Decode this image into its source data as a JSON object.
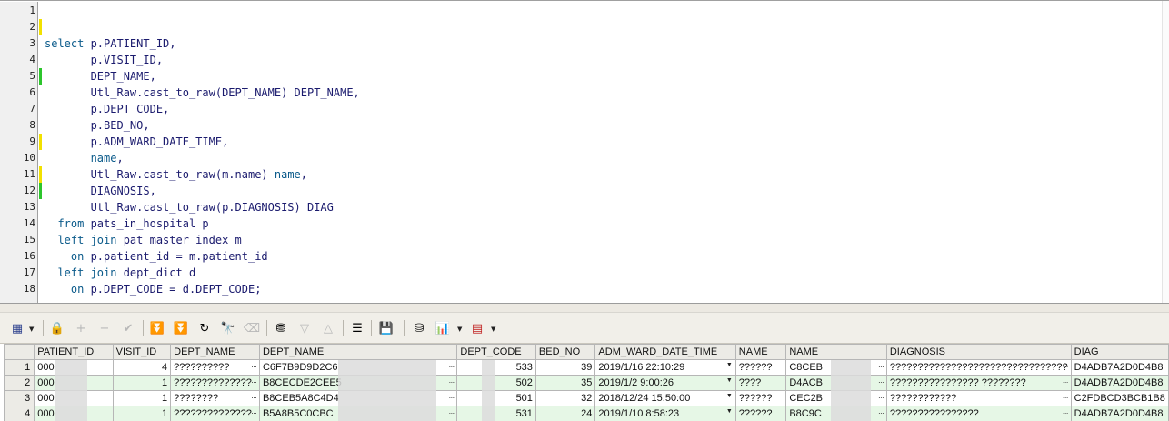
{
  "editor": {
    "lines": [
      {
        "n": "1",
        "segments": [],
        "mark": "none"
      },
      {
        "n": "2",
        "segments": [],
        "mark": "yellow"
      },
      {
        "n": "3",
        "segments": [
          {
            "t": "select",
            "k": true
          },
          {
            "t": " p.PATIENT_ID,",
            "k": false
          }
        ],
        "mark": "none"
      },
      {
        "n": "4",
        "segments": [
          {
            "t": "       p.VISIT_ID,",
            "k": false
          }
        ],
        "mark": "none"
      },
      {
        "n": "5",
        "segments": [
          {
            "t": "       DEPT_NAME,",
            "k": false
          }
        ],
        "mark": "green"
      },
      {
        "n": "6",
        "segments": [
          {
            "t": "       Utl_Raw.cast_to_raw(DEPT_NAME) DEPT_NAME,",
            "k": false
          }
        ],
        "mark": "none"
      },
      {
        "n": "7",
        "segments": [
          {
            "t": "       p.DEPT_CODE,",
            "k": false
          }
        ],
        "mark": "none"
      },
      {
        "n": "8",
        "segments": [
          {
            "t": "       p.BED_NO,",
            "k": false
          }
        ],
        "mark": "none"
      },
      {
        "n": "9",
        "segments": [
          {
            "t": "       p.ADM_WARD_DATE_TIME,",
            "k": false
          }
        ],
        "mark": "yellow"
      },
      {
        "n": "10",
        "segments": [
          {
            "t": "       ",
            "k": false
          },
          {
            "t": "name",
            "k": true
          },
          {
            "t": ",",
            "k": false
          }
        ],
        "mark": "none"
      },
      {
        "n": "11",
        "segments": [
          {
            "t": "       Utl_Raw.cast_to_raw(m.name) ",
            "k": false
          },
          {
            "t": "name",
            "k": true
          },
          {
            "t": ",",
            "k": false
          }
        ],
        "mark": "yellow"
      },
      {
        "n": "12",
        "segments": [
          {
            "t": "       DIAGNOSIS,",
            "k": false
          }
        ],
        "mark": "green"
      },
      {
        "n": "13",
        "segments": [
          {
            "t": "       Utl_Raw.cast_to_raw(p.DIAGNOSIS) DIAG",
            "k": false
          }
        ],
        "mark": "none"
      },
      {
        "n": "14",
        "segments": [
          {
            "t": "  ",
            "k": false
          },
          {
            "t": "from",
            "k": true
          },
          {
            "t": " pats_in_hospital p",
            "k": false
          }
        ],
        "mark": "none"
      },
      {
        "n": "15",
        "segments": [
          {
            "t": "  ",
            "k": false
          },
          {
            "t": "left join",
            "k": true
          },
          {
            "t": " pat_master_index m",
            "k": false
          }
        ],
        "mark": "none"
      },
      {
        "n": "16",
        "segments": [
          {
            "t": "    ",
            "k": false
          },
          {
            "t": "on",
            "k": true
          },
          {
            "t": " p.patient_id = m.patient_id",
            "k": false
          }
        ],
        "mark": "none"
      },
      {
        "n": "17",
        "segments": [
          {
            "t": "  ",
            "k": false
          },
          {
            "t": "left join",
            "k": true
          },
          {
            "t": " dept_dict d",
            "k": false
          }
        ],
        "mark": "none"
      },
      {
        "n": "18",
        "segments": [
          {
            "t": "    ",
            "k": false
          },
          {
            "t": "on",
            "k": true
          },
          {
            "t": " p.DEPT_CODE = d.DEPT_CODE;",
            "k": false
          }
        ],
        "mark": "none"
      }
    ]
  },
  "toolbar": {
    "buttons": [
      {
        "name": "grid-view-icon",
        "glyph": "▦",
        "dim": false
      },
      {
        "name": "lock-icon",
        "glyph": "🔒",
        "dim": false
      },
      {
        "name": "add-row-icon",
        "glyph": "+",
        "dim": true
      },
      {
        "name": "delete-row-icon",
        "glyph": "−",
        "dim": true
      },
      {
        "name": "post-changes-icon",
        "glyph": "✔",
        "dim": true
      },
      {
        "name": "fetch-next-icon",
        "glyph": "⏬",
        "dim": false
      },
      {
        "name": "fetch-last-icon",
        "glyph": "⏬",
        "dim": false
      },
      {
        "name": "refresh-icon",
        "glyph": "↻",
        "dim": false
      },
      {
        "name": "find-icon",
        "glyph": "🔭",
        "dim": false
      },
      {
        "name": "clear-icon",
        "glyph": "⌫",
        "dim": true
      },
      {
        "name": "query-by-example-icon",
        "glyph": "⛃",
        "dim": false
      },
      {
        "name": "previous-record-icon",
        "glyph": "▽",
        "dim": true
      },
      {
        "name": "next-record-icon",
        "glyph": "△",
        "dim": true
      },
      {
        "name": "single-record-view-icon",
        "glyph": "☰",
        "dim": false
      },
      {
        "name": "save-icon",
        "glyph": "💾",
        "dim": false
      },
      {
        "name": "export-icon",
        "glyph": "⛁",
        "dim": false
      },
      {
        "name": "chart-icon",
        "glyph": "📊",
        "dim": false
      },
      {
        "name": "grid-options-icon",
        "glyph": "▤",
        "dim": false
      }
    ]
  },
  "grid": {
    "colors": {
      "even_row": "#e6f7e6",
      "header": "#ecebe6"
    },
    "columns": [
      "PATIENT_ID",
      "VISIT_ID",
      "DEPT_NAME",
      "DEPT_NAME",
      "DEPT_CODE",
      "BED_NO",
      "ADM_WARD_DATE_TIME",
      "NAME",
      "NAME",
      "DIAGNOSIS",
      "DIAG"
    ],
    "rows": [
      {
        "no": "1",
        "cells": [
          "000",
          "4",
          "??????????",
          "C6F7B9D9D2C6",
          "533",
          "39",
          "2019/1/16 22:10:29",
          "??????",
          "C8CEB",
          "????????????????????????????????",
          "D4ADB7A2D0D4B8"
        ]
      },
      {
        "no": "2",
        "cells": [
          "000",
          "1",
          "??????????????",
          "B8CECDE2CEE5",
          "502",
          "35",
          "2019/1/2 9:00:26",
          "????",
          "D4ACB",
          "???????????????? ????????",
          "D4ADB7A2D0D4B8"
        ]
      },
      {
        "no": "3",
        "cells": [
          "000",
          "1",
          "????????",
          "B8CEB5A8C4D4",
          "501",
          "32",
          "2018/12/24 15:50:00",
          "??????",
          "CEC2B",
          "????????????",
          "C2FDBCD3BCB1B8"
        ]
      },
      {
        "no": "4",
        "cells": [
          "000",
          "1",
          "??????????????",
          "B5A8B5C0CBC",
          "531",
          "24",
          "2019/1/10 8:58:23",
          "??????",
          "B8C9C",
          "????????????????",
          "D4ADB7A2D0D4B8"
        ]
      }
    ]
  }
}
